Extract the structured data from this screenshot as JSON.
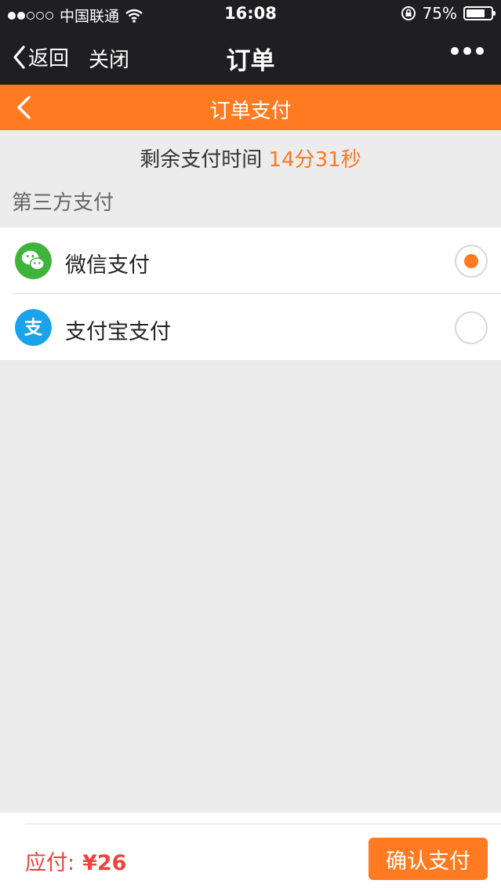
{
  "status_bar": {
    "carrier": "中国联通",
    "time": "16:08",
    "battery_text": "75%",
    "battery_level": 0.75
  },
  "wechat_bar": {
    "back_label": "返回",
    "close_label": "关闭",
    "title": "订单"
  },
  "header": {
    "title": "订单支付"
  },
  "countdown": {
    "label": "剩余支付时间",
    "time": "14分31秒"
  },
  "section": {
    "label": "第三方支付"
  },
  "payment_methods": [
    {
      "label": "微信支付",
      "icon": "wechat-icon",
      "color": "#3fb33b",
      "selected": true
    },
    {
      "label": "支付宝支付",
      "icon": "alipay-icon",
      "color": "#1aa3e8",
      "selected": false
    }
  ],
  "footer": {
    "amount_label": "应付:",
    "amount_value": "¥26",
    "confirm_label": "确认支付"
  },
  "colors": {
    "accent": "#ff7a21",
    "price": "#f0413c",
    "dark_bar": "#1f1f21"
  }
}
